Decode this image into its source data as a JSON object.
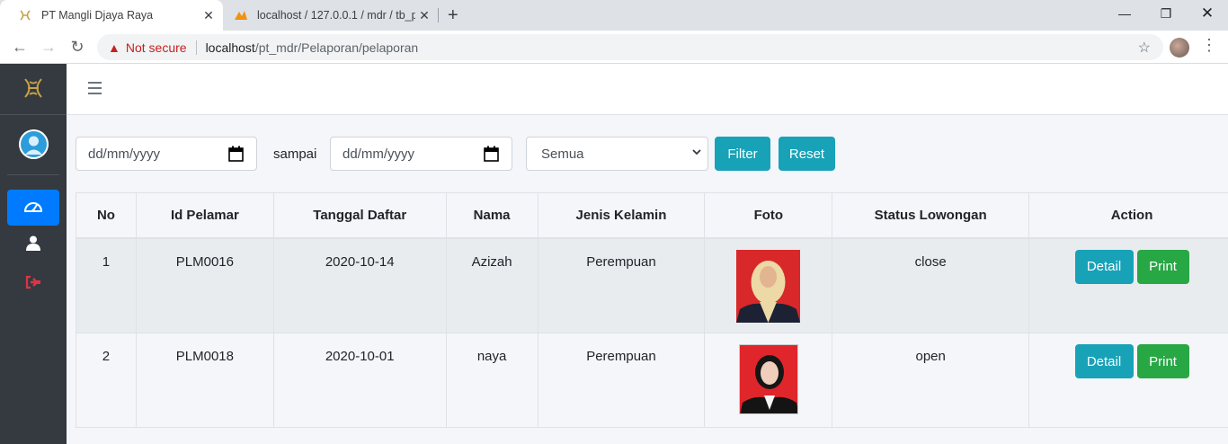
{
  "browser": {
    "tabs": [
      {
        "title": "PT Mangli Djaya Raya"
      },
      {
        "title": "localhost / 127.0.0.1 / mdr / tb_p"
      }
    ],
    "security_label": "Not secure",
    "url_host": "localhost",
    "url_path": "/pt_mdr/Pelaporan/pelaporan"
  },
  "filter": {
    "date_from_placeholder": "dd/mm/yyyy",
    "sampai_label": "sampai",
    "date_to_placeholder": "dd/mm/yyyy",
    "status_selected": "Semua",
    "filter_label": "Filter",
    "reset_label": "Reset"
  },
  "table": {
    "headers": [
      "No",
      "Id Pelamar",
      "Tanggal Daftar",
      "Nama",
      "Jenis Kelamin",
      "Foto",
      "Status Lowongan",
      "Action"
    ],
    "rows": [
      {
        "no": "1",
        "id": "PLM0016",
        "tanggal": "2020-10-14",
        "nama": "Azizah",
        "jk": "Perempuan",
        "status": "close",
        "detail": "Detail",
        "print": "Print"
      },
      {
        "no": "2",
        "id": "PLM0018",
        "tanggal": "2020-10-01",
        "nama": "naya",
        "jk": "Perempuan",
        "status": "open",
        "detail": "Detail",
        "print": "Print"
      }
    ]
  },
  "colors": {
    "sidebar": "#343a40",
    "primary": "#007bff",
    "info": "#17a2b8",
    "success": "#28a745",
    "logout": "#dc3545"
  },
  "icons": [
    "tab-logo-icon",
    "phpmyadmin-icon",
    "tab-close-icon",
    "new-tab-icon",
    "back-icon",
    "forward-icon",
    "reload-icon",
    "warning-icon",
    "bookmark-star-icon",
    "menu-kebab-icon",
    "hamburger-icon",
    "dashboard-icon",
    "user-icon",
    "logout-icon",
    "calendar-icon",
    "chevron-down-icon"
  ]
}
